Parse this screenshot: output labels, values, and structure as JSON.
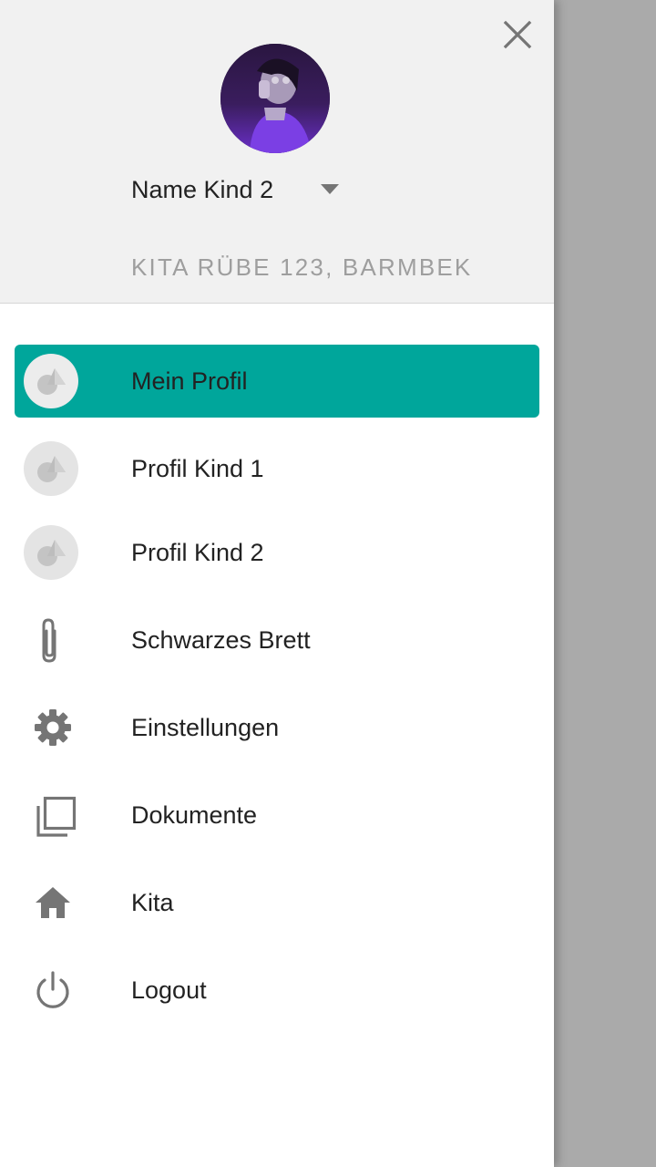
{
  "header": {
    "child_name": "Name Kind 2",
    "kita_name": "KITA RÜBE 123, BARMBEK"
  },
  "menu": {
    "items": [
      {
        "label": "Mein Profil",
        "icon": "avatar-placeholder-icon",
        "active": true
      },
      {
        "label": "Profil Kind 1",
        "icon": "avatar-placeholder-icon",
        "active": false
      },
      {
        "label": "Profil Kind 2",
        "icon": "avatar-placeholder-icon",
        "active": false
      },
      {
        "label": "Schwarzes Brett",
        "icon": "paperclip-icon",
        "active": false
      },
      {
        "label": "Einstellungen",
        "icon": "gear-icon",
        "active": false
      },
      {
        "label": "Dokumente",
        "icon": "documents-icon",
        "active": false
      },
      {
        "label": "Kita",
        "icon": "home-icon",
        "active": false
      },
      {
        "label": "Logout",
        "icon": "power-icon",
        "active": false
      }
    ]
  },
  "colors": {
    "accent": "#00a69b",
    "header_bg": "#f1f1f1",
    "backdrop": "#aaaaaa",
    "icon_gray": "#757575",
    "text": "#222222",
    "subtext": "#9e9e9e"
  }
}
